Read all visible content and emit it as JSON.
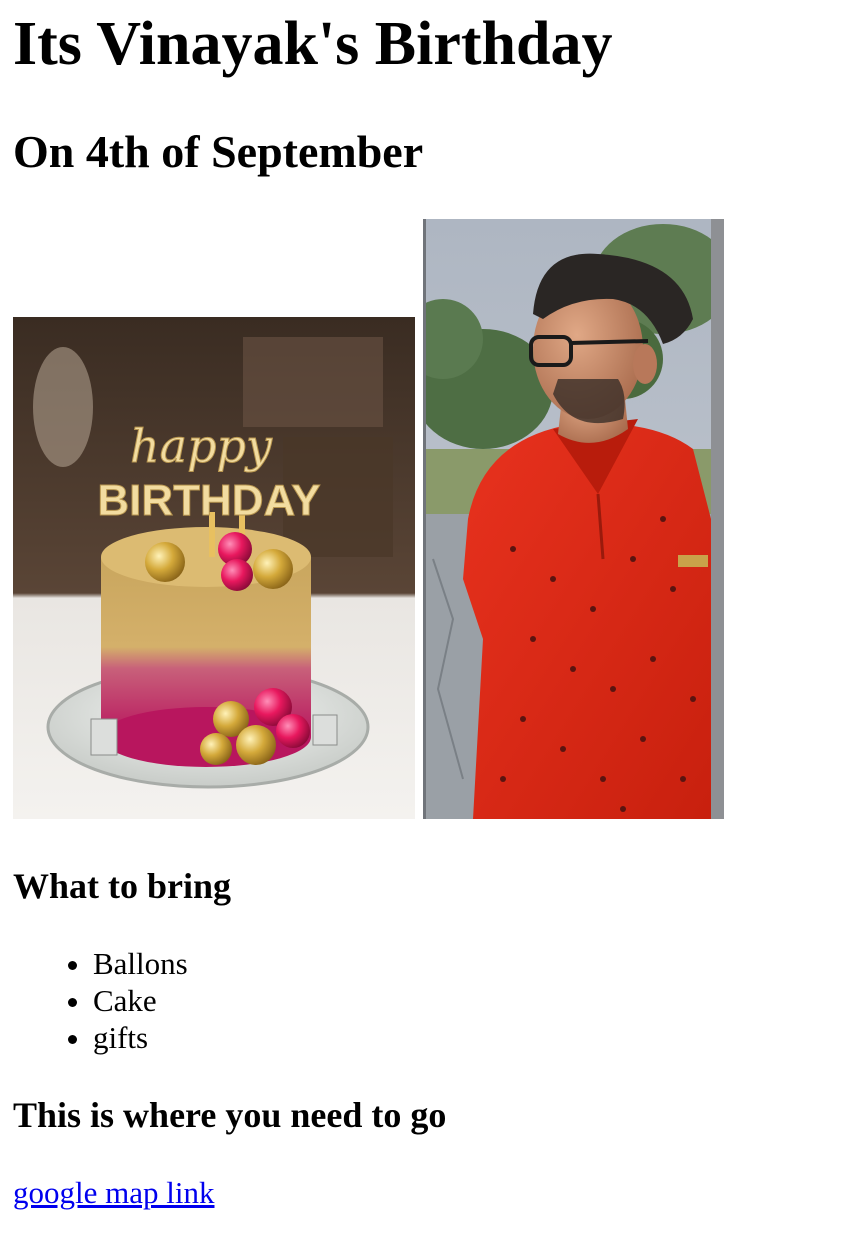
{
  "page": {
    "title": "Its Vinayak's Birthday",
    "date_heading": "On 4th of September"
  },
  "images": {
    "cake": {
      "topper_line1": "happy",
      "topper_line2": "BIRTHDAY"
    },
    "person": {}
  },
  "bring": {
    "title": "What to bring",
    "items": [
      "Ballons",
      "Cake",
      "gifts"
    ]
  },
  "directions": {
    "title": "This is where you need to go",
    "link_label": "google map link"
  },
  "colors": {
    "link": "#0000ee",
    "text": "#000000",
    "background": "#ffffff"
  }
}
